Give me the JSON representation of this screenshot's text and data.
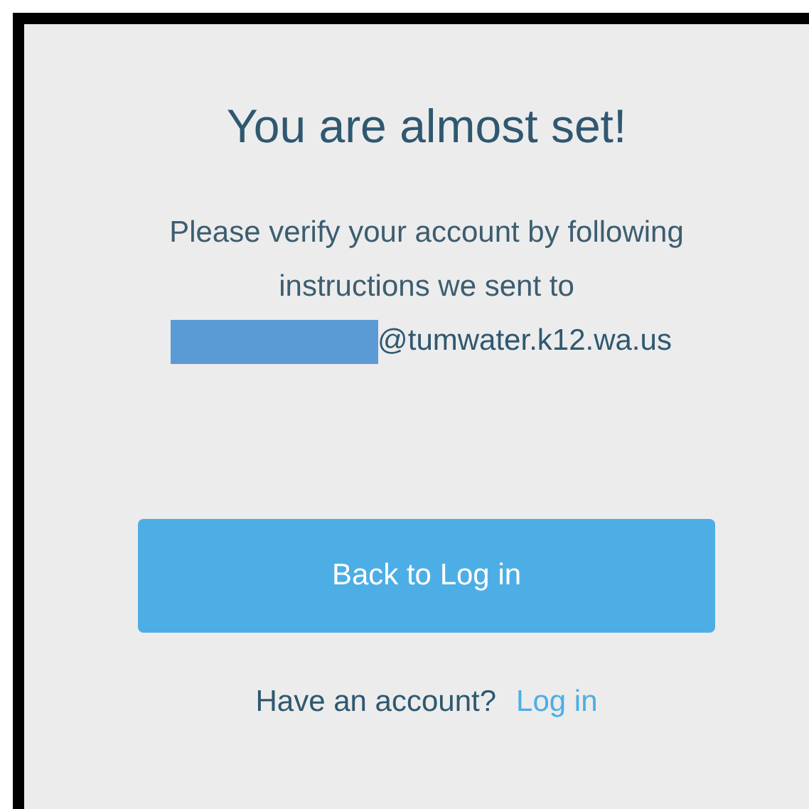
{
  "title": "You are almost set!",
  "message": "Please verify your account by following instructions we sent to",
  "email": "@tumwater.k12.wa.us",
  "primary_button": "Back to Log in",
  "footer": {
    "prompt": "Have an account?",
    "link": "Log in"
  }
}
